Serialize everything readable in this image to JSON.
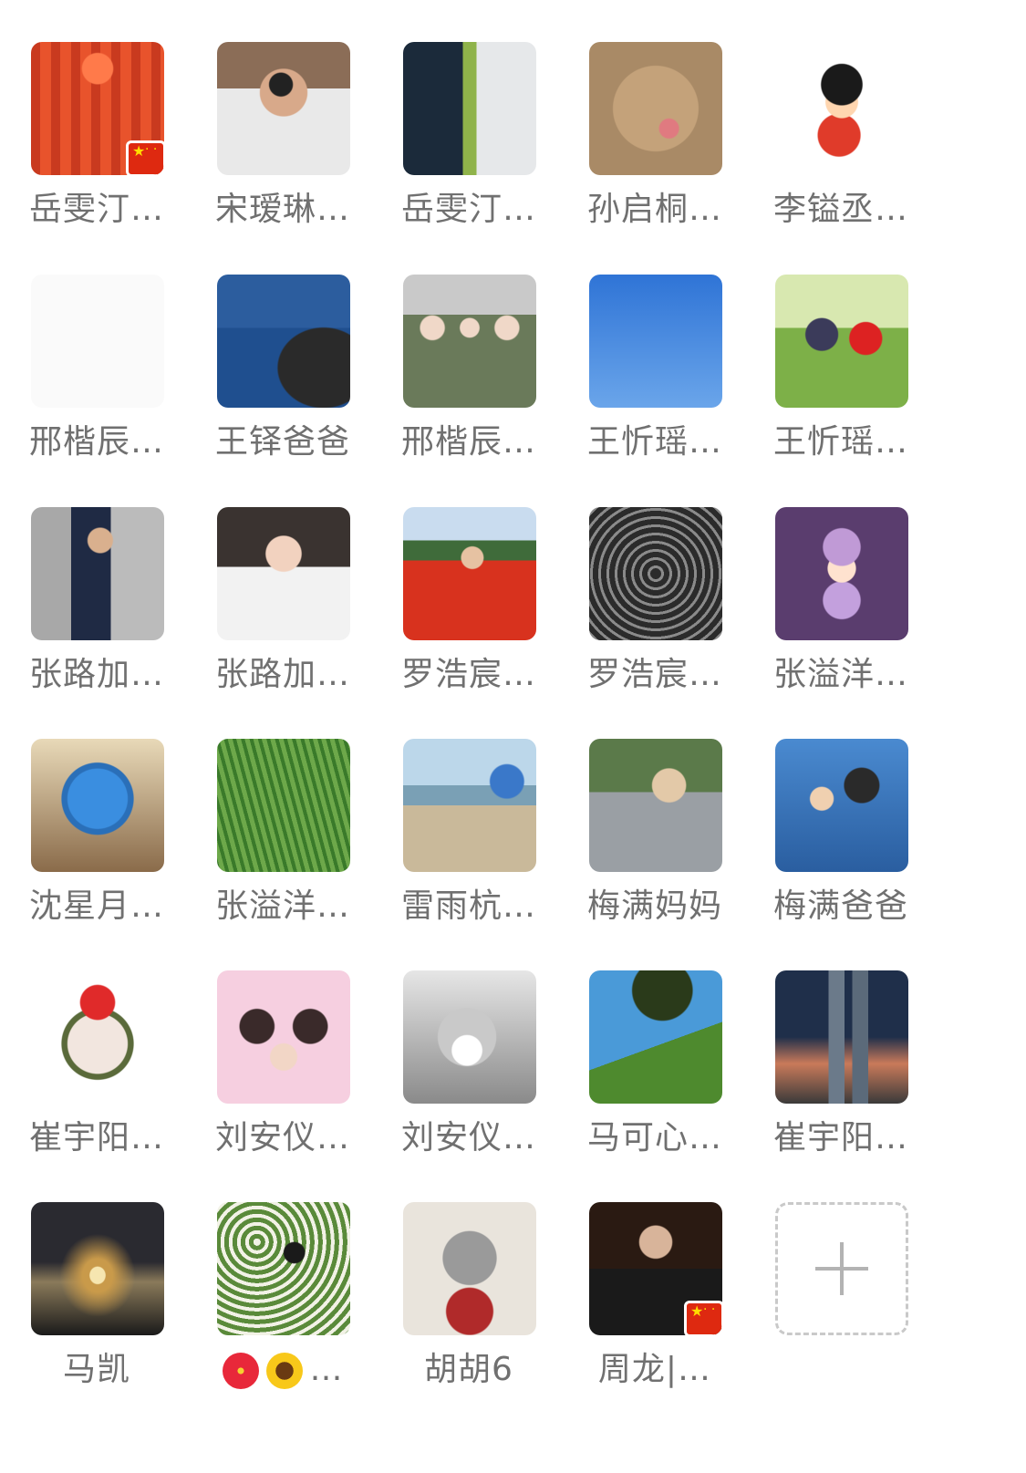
{
  "members": [
    {
      "name": "岳雯汀…",
      "avatar": "red-tower-photo",
      "flag": true
    },
    {
      "name": "宋瑷琳…",
      "avatar": "man-sunglasses-photo",
      "flag": false
    },
    {
      "name": "岳雯汀…",
      "avatar": "masked-person-panel-photo",
      "flag": false
    },
    {
      "name": "孙启桐…",
      "avatar": "fluffy-dog-photo",
      "flag": false
    },
    {
      "name": "李镒丞…",
      "avatar": "cartoon-boy-monkey-tail",
      "flag": false
    },
    {
      "name": "邢楷辰…",
      "avatar": "blank-avatar",
      "flag": false
    },
    {
      "name": "王铎爸爸",
      "avatar": "ocean-rocks-photo",
      "flag": false
    },
    {
      "name": "邢楷辰…",
      "avatar": "three-women-masks-photo",
      "flag": false
    },
    {
      "name": "王忻瑶…",
      "avatar": "blue-sky-photo",
      "flag": false
    },
    {
      "name": "王忻瑶…",
      "avatar": "two-kids-grass-photo",
      "flag": false
    },
    {
      "name": "张路加…",
      "avatar": "young-man-photo",
      "flag": false
    },
    {
      "name": "张路加…",
      "avatar": "woman-white-blouse-photo",
      "flag": false
    },
    {
      "name": "罗浩宸…",
      "avatar": "woman-red-flowers-photo",
      "flag": false
    },
    {
      "name": "罗浩宸…",
      "avatar": "tunnel-silhouette-photo",
      "flag": false
    },
    {
      "name": "张溢洋…",
      "avatar": "cartoon-girl-hat",
      "flag": false
    },
    {
      "name": "沈星月…",
      "avatar": "globe-photo",
      "flag": false
    },
    {
      "name": "张溢洋…",
      "avatar": "tall-grass-photo",
      "flag": false
    },
    {
      "name": "雷雨杭…",
      "avatar": "child-beach-photo",
      "flag": false
    },
    {
      "name": "梅满妈妈",
      "avatar": "child-fountain-photo",
      "flag": false
    },
    {
      "name": "梅满爸爸",
      "avatar": "father-child-ride-photo",
      "flag": false
    },
    {
      "name": "崔宇阳…",
      "avatar": "woman-christmas-hat-portrait",
      "flag": false
    },
    {
      "name": "刘安仪…",
      "avatar": "cartoon-family-drawing",
      "flag": false
    },
    {
      "name": "刘安仪…",
      "avatar": "masked-banknote",
      "flag": false
    },
    {
      "name": "马可心…",
      "avatar": "tree-hill-photo",
      "flag": false
    },
    {
      "name": "崔宇阳…",
      "avatar": "skyscraper-photo",
      "flag": false
    },
    {
      "name": "马凯",
      "avatar": "dusk-rings-photo",
      "flag": false
    },
    {
      "name": "…",
      "avatar": "woman-blossom-tree-photo",
      "flag": false,
      "emojis": [
        "hibiscus-icon",
        "sunflower-icon"
      ]
    },
    {
      "name": "胡胡6",
      "avatar": "cat-painting",
      "flag": false
    },
    {
      "name": "周龙|…",
      "avatar": "man-suit-portrait",
      "flag": true
    }
  ],
  "add_button": {
    "icon": "plus-icon"
  }
}
